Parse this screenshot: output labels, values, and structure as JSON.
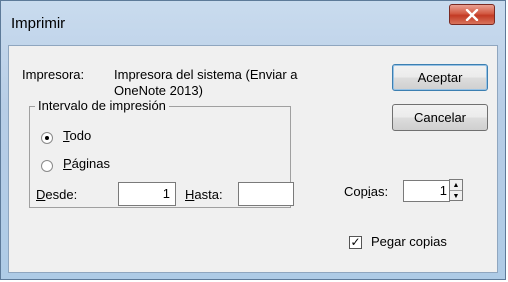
{
  "window": {
    "title": "Imprimir"
  },
  "printer": {
    "label": "Impresora:",
    "name_line1": "Impresora del sistema (Enviar a",
    "name_line2": "OneNote 2013)"
  },
  "buttons": {
    "ok": "Aceptar",
    "cancel": "Cancelar"
  },
  "range": {
    "legend": "Intervalo de impresión",
    "all_first": "T",
    "all_rest": "odo",
    "pages_first": "P",
    "pages_rest": "áginas",
    "from_first": "D",
    "from_rest": "esde:",
    "from_value": "1",
    "to_first": "H",
    "to_rest": "asta:",
    "to_value": ""
  },
  "copies": {
    "label_prefix": "Cop",
    "label_mnemonic": "i",
    "label_suffix": "as:",
    "value": "1"
  },
  "collate": {
    "label": "Pegar copias",
    "checked": true
  }
}
